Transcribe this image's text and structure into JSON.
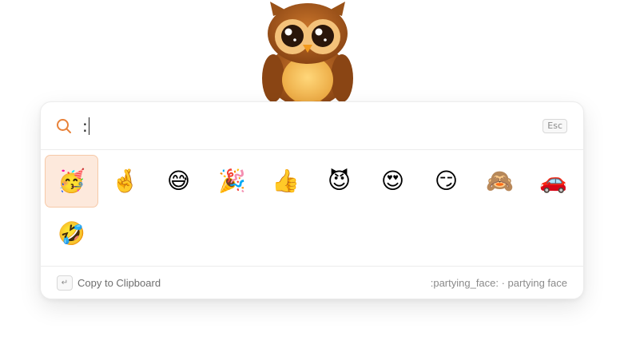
{
  "search": {
    "query": ":",
    "esc_label": "Esc"
  },
  "emojis": [
    {
      "char": "🥳",
      "selected": true
    },
    {
      "char": "🤞",
      "selected": false
    },
    {
      "char": "😅",
      "selected": false
    },
    {
      "char": "🎉",
      "selected": false
    },
    {
      "char": "👍",
      "selected": false
    },
    {
      "char": "😈",
      "selected": false
    },
    {
      "char": "😍",
      "selected": false
    },
    {
      "char": "😏",
      "selected": false
    },
    {
      "char": "🙈",
      "selected": false
    },
    {
      "char": "🚗",
      "selected": false
    },
    {
      "char": "🤣",
      "selected": false
    }
  ],
  "footer": {
    "enter_key": "↵",
    "action_label": "Copy to Clipboard",
    "selected_info": ":partying_face: · partying face"
  },
  "colors": {
    "accent": "#e8823a",
    "selected_bg": "#fde9dc"
  }
}
